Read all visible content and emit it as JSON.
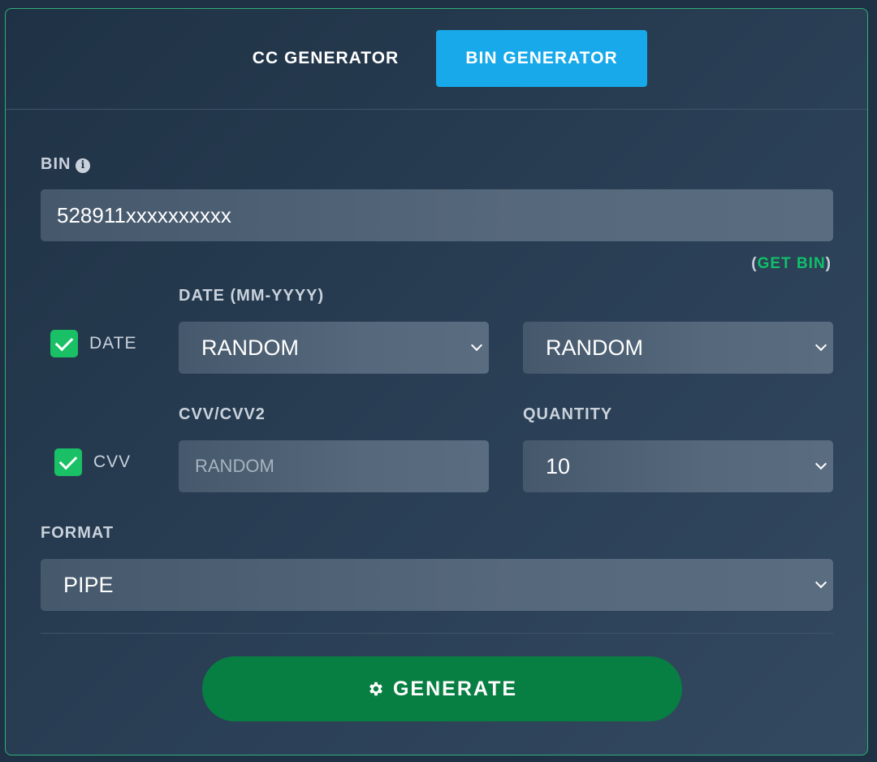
{
  "tabs": [
    {
      "label": "CC GENERATOR",
      "active": false
    },
    {
      "label": "BIN GENERATOR",
      "active": true
    }
  ],
  "bin": {
    "label": "BIN",
    "info_icon": "info-circle-icon",
    "value": "528911xxxxxxxxxx"
  },
  "get_bin": {
    "open": "(",
    "link": "GET BIN",
    "close": ")"
  },
  "date": {
    "checkbox_label": "DATE",
    "checked": true,
    "label": "DATE (MM-YYYY)",
    "month_selected": "RANDOM",
    "year_selected": "RANDOM"
  },
  "cvv": {
    "checkbox_label": "CVV",
    "checked": true,
    "label": "CVV/CVV2",
    "placeholder": "RANDOM"
  },
  "quantity": {
    "label": "QUANTITY",
    "selected": "10"
  },
  "format": {
    "label": "FORMAT",
    "selected": "PIPE"
  },
  "generate": {
    "label": "GENERATE",
    "icon": "gear-icon"
  },
  "colors": {
    "accent_blue": "#17a9ea",
    "accent_green": "#10c06a",
    "button_green": "#087f42",
    "border_green": "#2fae7a"
  }
}
